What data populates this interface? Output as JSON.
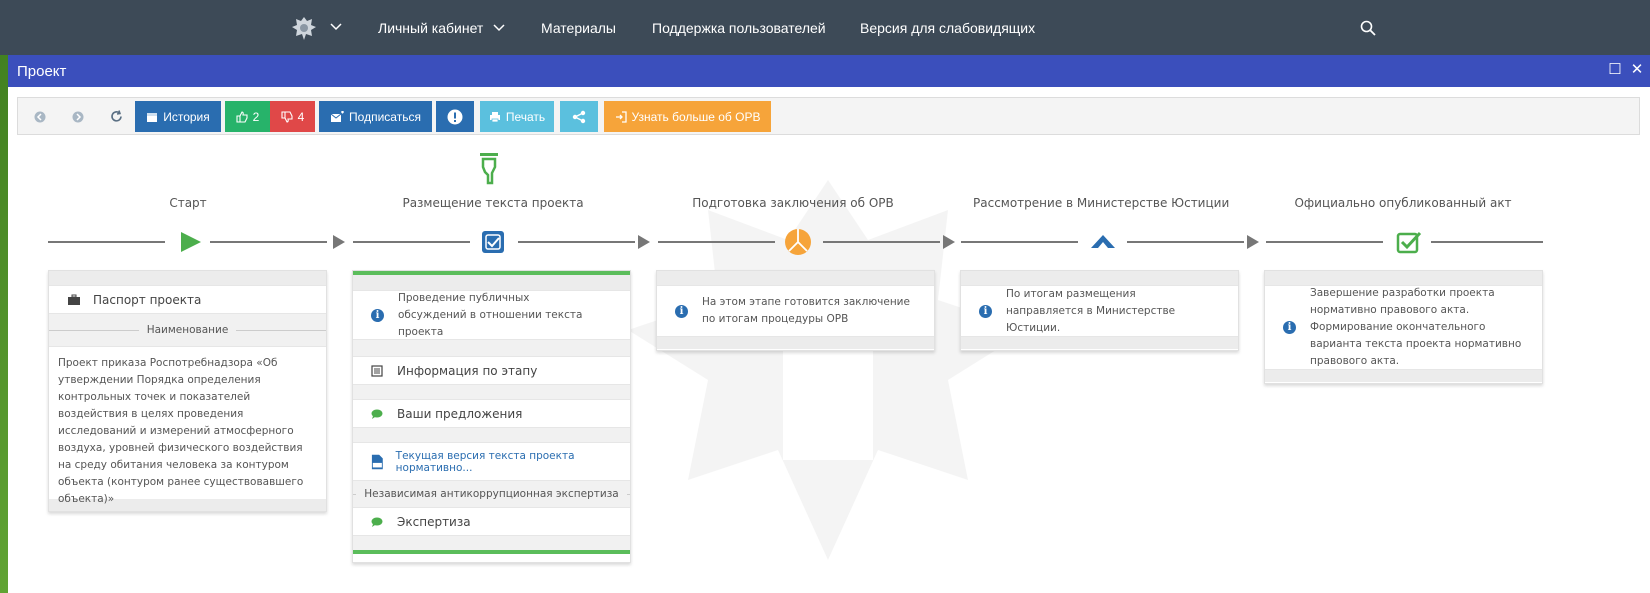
{
  "topnav": {
    "items": [
      "Личный кабинет",
      "Материалы",
      "Поддержка пользователей",
      "Версия для слабовидящих"
    ]
  },
  "window": {
    "title": "Проект"
  },
  "toolbar": {
    "history": "История",
    "likes": "2",
    "dislikes": "4",
    "subscribe": "Подписаться",
    "print": "Печать",
    "learn_more": "Узнать больше об ОРВ"
  },
  "stages": [
    {
      "label": "Старт"
    },
    {
      "label": "Размещение текста проекта"
    },
    {
      "label": "Подготовка заключения об ОРВ"
    },
    {
      "label": "Рассмотрение в Министерстве Юстиции"
    },
    {
      "label": "Официально опубликованный акт"
    }
  ],
  "panel1": {
    "passport": "Паспорт проекта",
    "name_sep": "Наименование",
    "name_text": "Проект приказа Роспотребнадзора «Об утверждении Порядка определения контрольных точек и показателей воздействия в целях проведения исследований и измерений атмосферного воздуха, уровней физического воздействия на среду обитания человека за контуром объекта (контуром ранее существовавшего объекта)»"
  },
  "panel2": {
    "info": "Проведение публичных обсуждений в отношении текста проекта",
    "stage_info": "Информация по этапу",
    "proposals": "Ваши предложения",
    "current_version": "Текущая версия текста проекта нормативно...",
    "anticorruption": "Независимая антикоррупционная экспертиза",
    "expertise": "Экспертиза"
  },
  "panel3": {
    "info": "На этом этапе готовится заключение по итогам процедуры ОРВ"
  },
  "panel4": {
    "info": "По итогам размещения направляется в Министерстве Юстиции."
  },
  "panel5": {
    "info": "Завершение разработки проекта нормативно правового акта. Формирование окончательного варианта текста проекта нормативно правового акта."
  },
  "colors": {
    "nav": "#3d4a57",
    "titlebar": "#3b4fbc",
    "accent_green": "#5bbd5b",
    "accent_orange": "#f6a43a",
    "accent_blue": "#2a6db0"
  },
  "icons": [
    "emblem-icon",
    "chevron-down-icon",
    "search-icon",
    "back-icon",
    "forward-icon",
    "refresh-icon",
    "calendar-icon",
    "thumbs-up-icon",
    "thumbs-down-icon",
    "subscribe-icon",
    "exclamation-icon",
    "print-icon",
    "share-icon",
    "sign-in-icon",
    "play-icon",
    "checkbox-icon",
    "pie-icon",
    "chevron-up-icon",
    "check-square-icon",
    "hand-pointer-icon",
    "briefcase-icon",
    "info-icon",
    "list-icon",
    "comment-icon",
    "document-icon"
  ]
}
